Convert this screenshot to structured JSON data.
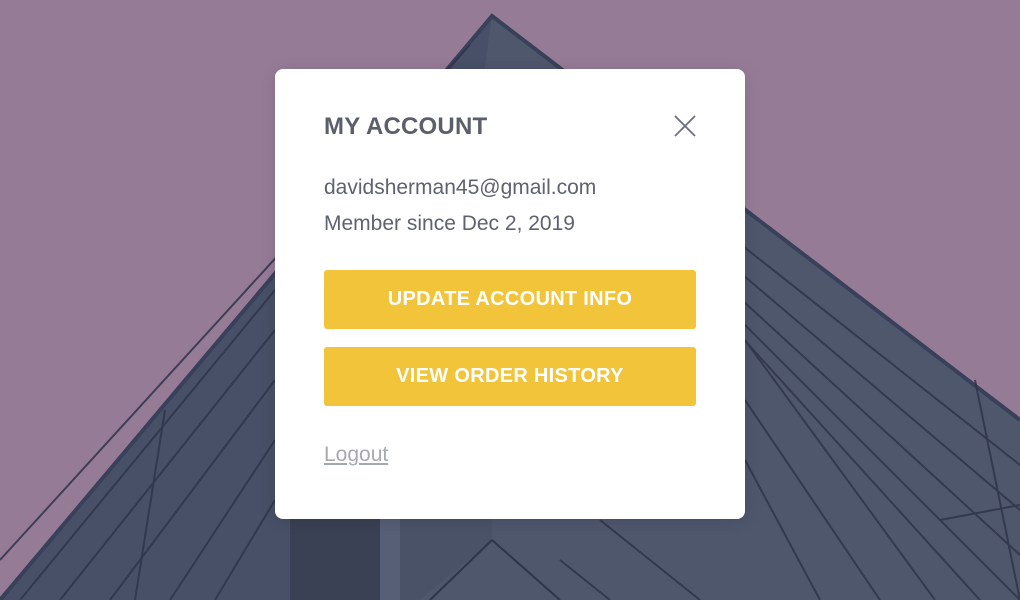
{
  "modal": {
    "title": "MY ACCOUNT",
    "close_icon": "close-icon",
    "email": "davidsherman45@gmail.com",
    "member_since": "Member since Dec 2, 2019",
    "buttons": {
      "update_account": "UPDATE ACCOUNT INFO",
      "view_orders": "VIEW ORDER HISTORY"
    },
    "logout_label": "Logout"
  },
  "colors": {
    "accent": "#f1c43a",
    "sky": "#967b97",
    "building": "#4f576d",
    "heading": "#5b5e6b",
    "muted_link": "#a7a9b1"
  }
}
